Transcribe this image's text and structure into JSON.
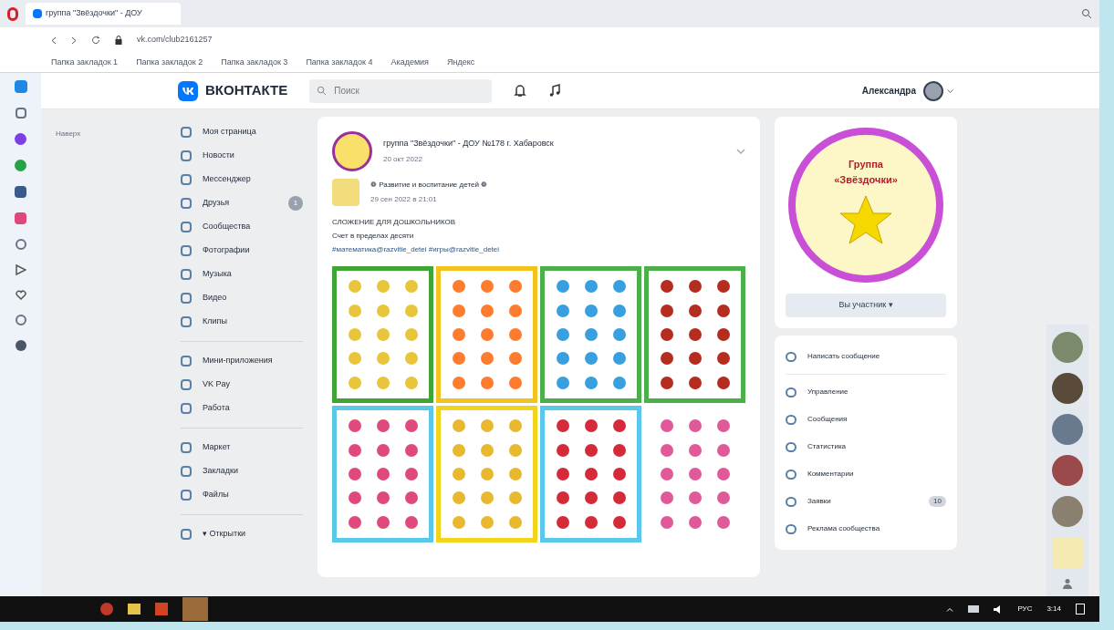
{
  "browser": {
    "tab_title": "группа \"Звёздочки\" - ДОУ",
    "address": "vk.com/club2161257",
    "bookmarks": [
      "Папка закладок 1",
      "Папка закладок 2",
      "Папка закладок 3",
      "Папка закладок 4",
      "Академия",
      "Яндекс"
    ]
  },
  "header": {
    "logo": "ВКОНТАКТЕ",
    "search": {
      "placeholder": "Поиск"
    },
    "user_name": "Александра"
  },
  "scroll_up": "Наверх",
  "nav": [
    {
      "label": "Моя страница"
    },
    {
      "label": "Новости"
    },
    {
      "label": "Мессенджер"
    },
    {
      "label": "Друзья",
      "badge": "1"
    },
    {
      "label": "Сообщества"
    },
    {
      "label": "Фотографии"
    },
    {
      "label": "Музыка"
    },
    {
      "label": "Видео"
    },
    {
      "label": "Клипы"
    },
    {
      "label": "Мини-приложения",
      "divider_before": true
    },
    {
      "label": "VK Pay"
    },
    {
      "label": "Работа"
    },
    {
      "label": "Маркет",
      "divider_before": true
    },
    {
      "label": "Закладки"
    },
    {
      "label": "Файлы"
    },
    {
      "label": "▾ Открытки",
      "divider_before": true
    }
  ],
  "post": {
    "author": "группа \"Звёздочки\" - ДОУ №178 г. Хабаровск",
    "date": "20 окт 2022",
    "repost": {
      "author": "❁ Развитие и воспитание детей ❁",
      "date": "29 сен 2022 в 21:01"
    },
    "lines": [
      "СЛОЖЕНИЕ ДЛЯ ДОШКОЛЬНИКОВ",
      "Счет в пределах десяти",
      "#математика@razvitie_detei #игры@razvitie_detei"
    ]
  },
  "group_card": {
    "logo_title": "Группа «Звёздочки»",
    "member_button": "Вы участник ▾"
  },
  "group_menu": [
    {
      "label": "Написать сообщение"
    },
    {
      "label": "Управление"
    },
    {
      "label": "Сообщения"
    },
    {
      "label": "Статистика"
    },
    {
      "label": "Комментарии"
    },
    {
      "label": "Заявки",
      "badge": "10"
    },
    {
      "label": "Реклама сообщества"
    }
  ],
  "taskbar": {
    "language": "РУС",
    "time": "3:14"
  }
}
